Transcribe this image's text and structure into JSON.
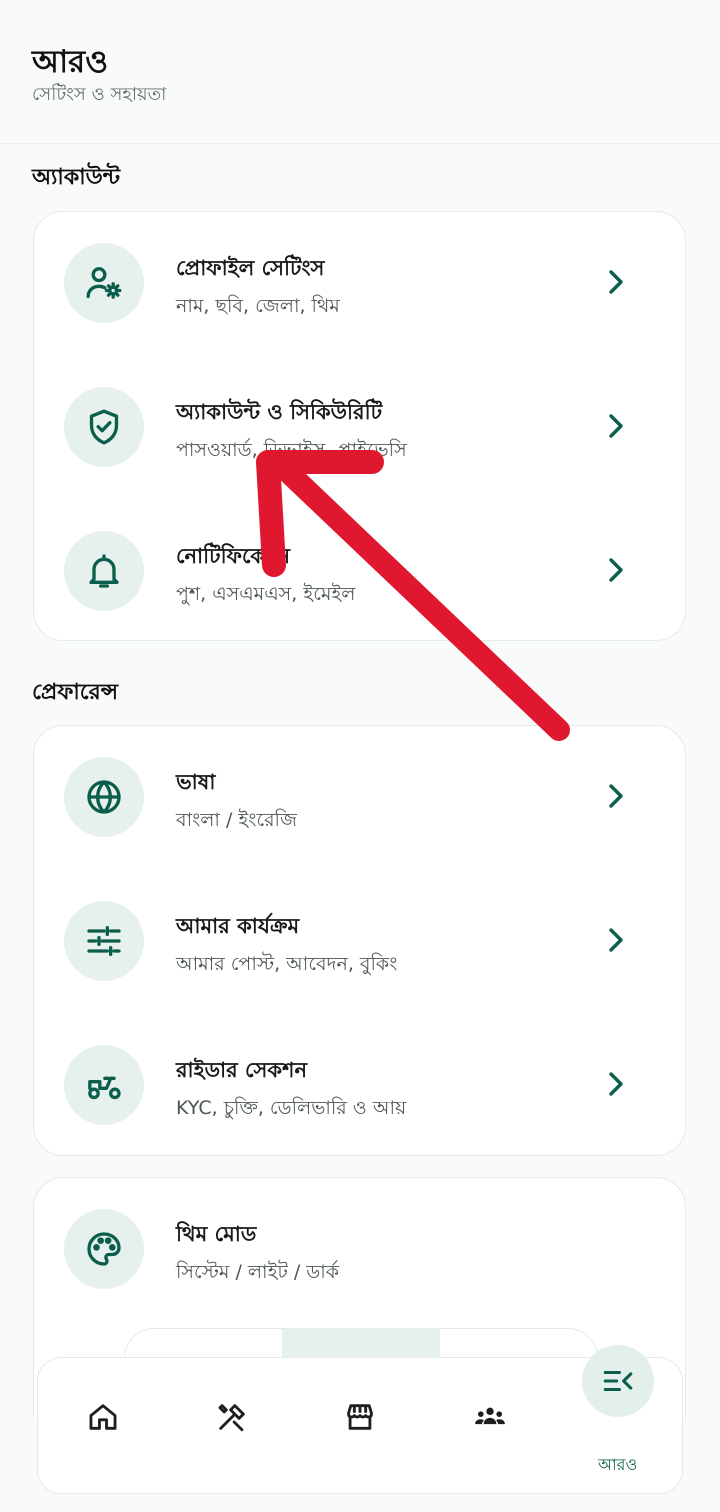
{
  "header": {
    "title": "আরও",
    "subtitle": "সেটিংস ও সহায়তা"
  },
  "sections": {
    "account": "অ্যাকাউন্ট",
    "preferences": "প্রেফারেন্স"
  },
  "account_items": [
    {
      "title": "প্রোফাইল সেটিংস",
      "subtitle": "নাম, ছবি, জেলা, থিম",
      "icon": "user-settings-icon"
    },
    {
      "title": "অ্যাকাউন্ট ও সিকিউরিটি",
      "subtitle": "পাসওয়ার্ড, ডিভাইস, প্রাইভেসি",
      "icon": "shield-check-icon"
    },
    {
      "title": "নোটিফিকেশন",
      "subtitle": "পুশ, এসএমএস, ইমেইল",
      "icon": "bell-icon"
    }
  ],
  "preference_items": [
    {
      "title": "ভাষা",
      "subtitle": "বাংলা / ইংরেজি",
      "icon": "globe-icon"
    },
    {
      "title": "আমার কার্যক্রম",
      "subtitle": "আমার পোস্ট, আবেদন, বুকিং",
      "icon": "sliders-icon"
    },
    {
      "title": "রাইডার সেকশন",
      "subtitle": "KYC, চুক্তি, ডেলিভারি ও আয়",
      "icon": "scooter-icon"
    }
  ],
  "theme_item": {
    "title": "থিম মোড",
    "subtitle": "সিস্টেম / লাইট / ডার্ক",
    "icon": "palette-icon"
  },
  "bottom_nav": {
    "more_label": "আরও",
    "items": [
      "home-icon",
      "tools-icon",
      "store-icon",
      "community-icon",
      "menu-icon"
    ]
  },
  "colors": {
    "accent": "#0b5e4c",
    "icon_bg": "#e6f0ec",
    "annotation_arrow": "#e0182f"
  }
}
